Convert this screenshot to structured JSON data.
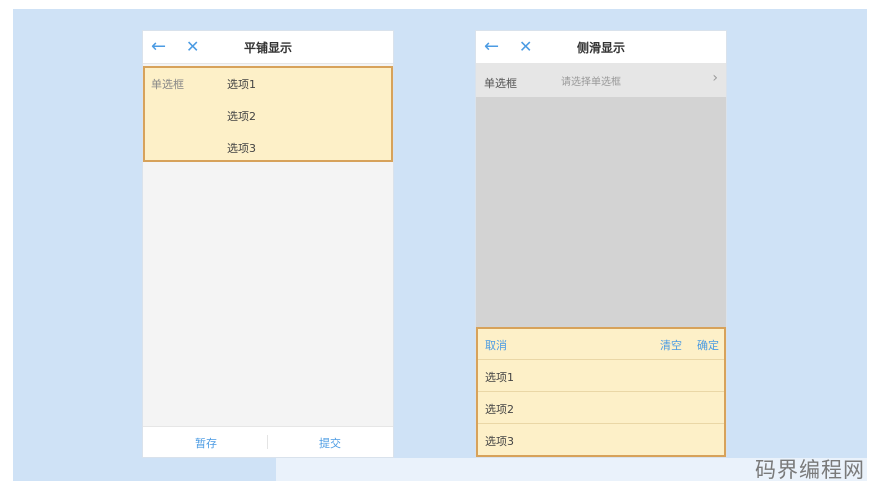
{
  "left_phone": {
    "title": "平铺显示",
    "back_icon": "←",
    "close_icon": "✕",
    "field_label": "单选框",
    "options": [
      "选项1",
      "选项2",
      "选项3"
    ],
    "save_label": "暂存",
    "submit_label": "提交"
  },
  "right_phone": {
    "title": "侧滑显示",
    "back_icon": "←",
    "close_icon": "✕",
    "field_label": "单选框",
    "placeholder": "请选择单选框",
    "chevron": "›",
    "cancel_label": "取消",
    "clear_label": "清空",
    "confirm_label": "确定",
    "options": [
      "选项1",
      "选项2",
      "选项3"
    ]
  },
  "watermark": "码界编程网"
}
